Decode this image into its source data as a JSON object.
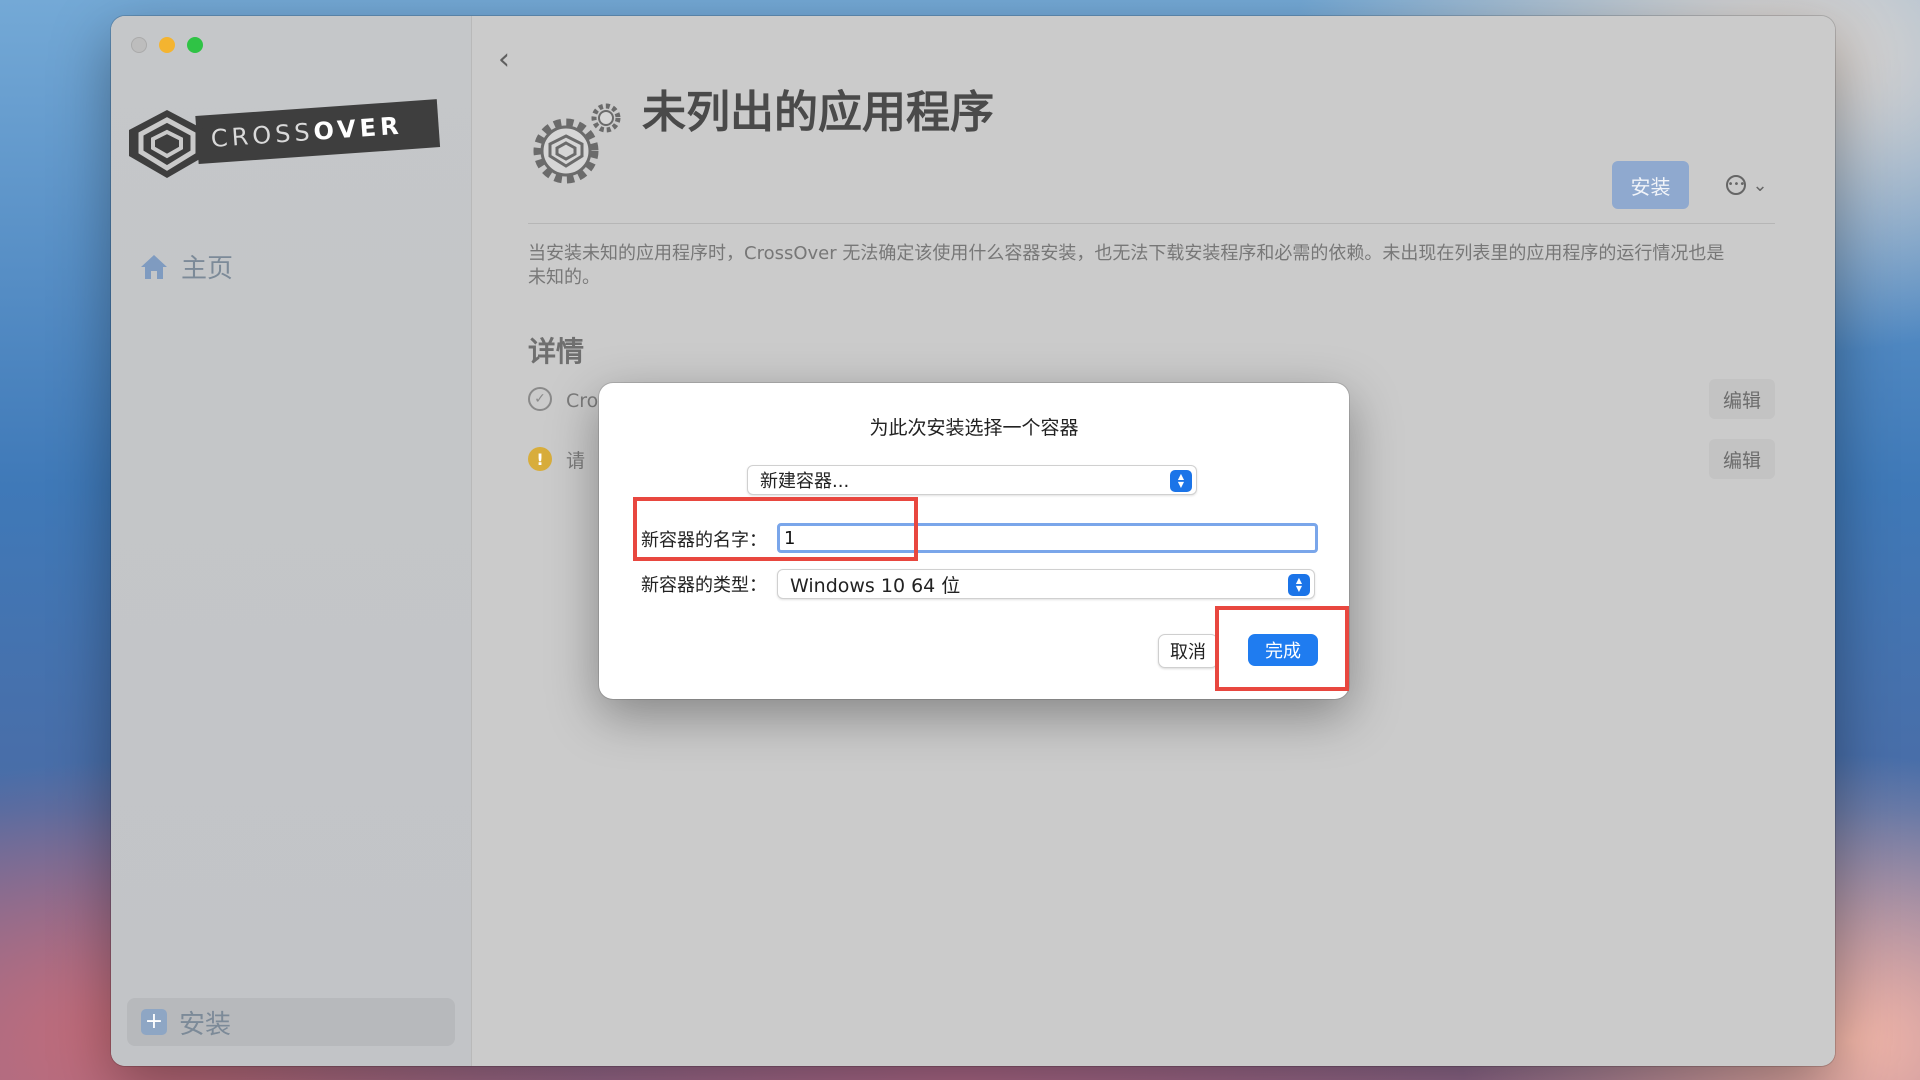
{
  "sidebar": {
    "logo_text_light": "CROSS",
    "logo_text_bold": "OVER",
    "home_label": "主页",
    "install_label": "安装",
    "home_icon": "house-icon",
    "install_icon": "plus-square-icon"
  },
  "main": {
    "title": "未列出的应用程序",
    "install_button": "安装",
    "more_icon": "ellipsis-circle-icon",
    "description": "当安装未知的应用程序时，CrossOver 无法确定该使用什么容器安装，也无法下载安装程序和必需的依赖。未出现在列表里的应用程序的运行情况也是未知的。",
    "details_heading": "详情",
    "details": [
      {
        "text": "CrossOver 将要从 /Volumes/K1bDf3fd3C775C14/Klaugrand_KeyGen.exe 安装该软件",
        "edit": "编辑",
        "status": "ok"
      },
      {
        "text": "请",
        "edit": "编辑",
        "status": "warning"
      }
    ]
  },
  "dialog": {
    "title": "为此次安装选择一个容器",
    "container_select": "新建容器...",
    "name_label": "新容器的名字：",
    "name_value": "1",
    "type_label": "新容器的类型：",
    "type_value": "Windows 10 64 位",
    "cancel": "取消",
    "done": "完成"
  },
  "colors": {
    "accent": "#1f7cf0",
    "highlight": "#e8473f",
    "install_button": "#8fa9cf"
  }
}
